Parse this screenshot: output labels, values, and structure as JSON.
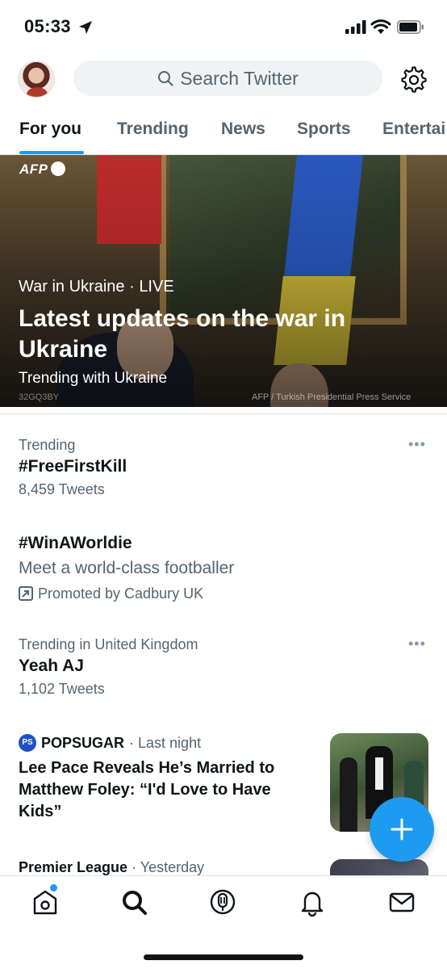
{
  "status_bar": {
    "time": "05:33"
  },
  "header": {
    "search_placeholder": "Search Twitter"
  },
  "tabs": [
    {
      "label": "For you",
      "active": true
    },
    {
      "label": "Trending",
      "active": false
    },
    {
      "label": "News",
      "active": false
    },
    {
      "label": "Sports",
      "active": false
    },
    {
      "label": "Entertai",
      "active": false
    }
  ],
  "hero": {
    "agency": "AFP",
    "topic": "War in Ukraine",
    "separator": "·",
    "live": "LIVE",
    "headline": "Latest updates on the war in Ukraine",
    "trending_with": "Trending with Ukraine",
    "photo_code": "32GQ3BY",
    "credit": "AFP / Turkish Presidential Press Service"
  },
  "trends": [
    {
      "context": "Trending",
      "name": "#FreeFirstKill",
      "count": "8,459 Tweets",
      "more": "•••"
    },
    {
      "name": "#WinAWorldie",
      "description": "Meet a world-class footballer",
      "promoted": "Promoted by Cadbury UK"
    },
    {
      "context": "Trending in United Kingdom",
      "name": "Yeah AJ",
      "count": "1,102 Tweets",
      "more": "•••"
    }
  ],
  "news": {
    "source_logo": "PS",
    "source": "POPSUGAR",
    "time": "· Last night",
    "title": "Lee Pace Reveals He’s Married to Matthew Foley: “I'd Love to Have Kids”"
  },
  "next_news": {
    "source": "Premier League",
    "time": "· Yesterday"
  },
  "colors": {
    "accent": "#1d9bf0",
    "text": "#0f1419",
    "secondary": "#536471"
  },
  "icons": [
    "location-arrow-icon",
    "signal-icon",
    "wifi-icon",
    "battery-icon",
    "search-icon",
    "gear-icon",
    "promoted-icon",
    "compose-plus-icon",
    "home-icon",
    "explore-search-icon",
    "spaces-icon",
    "notifications-bell-icon",
    "messages-mail-icon"
  ]
}
